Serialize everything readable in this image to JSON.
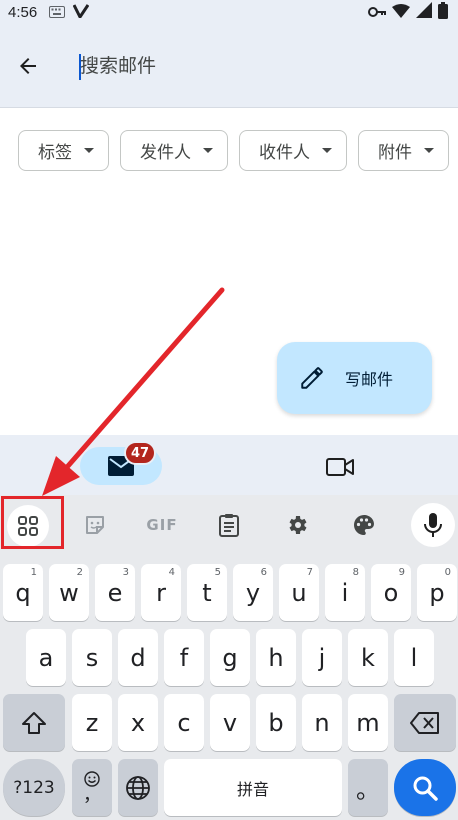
{
  "status_bar": {
    "time": "4:56",
    "icons": [
      "keyboard-icon",
      "v-icon",
      "key-icon",
      "wifi-icon",
      "signal-icon",
      "battery-icon"
    ]
  },
  "search": {
    "placeholder": "搜索邮件",
    "value": ""
  },
  "filters": [
    {
      "label": "标签"
    },
    {
      "label": "发件人"
    },
    {
      "label": "收件人"
    },
    {
      "label": "附件"
    }
  ],
  "compose": {
    "label": "写邮件"
  },
  "bottom_nav": {
    "mail_badge": "47",
    "items": [
      "mail-icon",
      "video-icon"
    ]
  },
  "keyboard": {
    "toolbar": [
      "apps-grid-icon",
      "sticker-icon",
      "GIF",
      "clipboard-icon",
      "settings-icon",
      "palette-icon",
      "mic-icon"
    ],
    "gif_label": "GIF",
    "row1": [
      {
        "key": "q",
        "hint": "1"
      },
      {
        "key": "w",
        "hint": "2"
      },
      {
        "key": "e",
        "hint": "3"
      },
      {
        "key": "r",
        "hint": "4"
      },
      {
        "key": "t",
        "hint": "5"
      },
      {
        "key": "y",
        "hint": "6"
      },
      {
        "key": "u",
        "hint": "7"
      },
      {
        "key": "i",
        "hint": "8"
      },
      {
        "key": "o",
        "hint": "9"
      },
      {
        "key": "p",
        "hint": "0"
      }
    ],
    "row2": [
      "a",
      "s",
      "d",
      "f",
      "g",
      "h",
      "j",
      "k",
      "l"
    ],
    "row3": [
      "z",
      "x",
      "c",
      "v",
      "b",
      "n",
      "m"
    ],
    "symbols_label": "?123",
    "comma": "，",
    "space_label": "拼音",
    "period": "。"
  },
  "colors": {
    "accent": "#1a73e8",
    "annotation": "#e3262b",
    "fab": "#c2e7ff",
    "badge": "#b3261e"
  }
}
